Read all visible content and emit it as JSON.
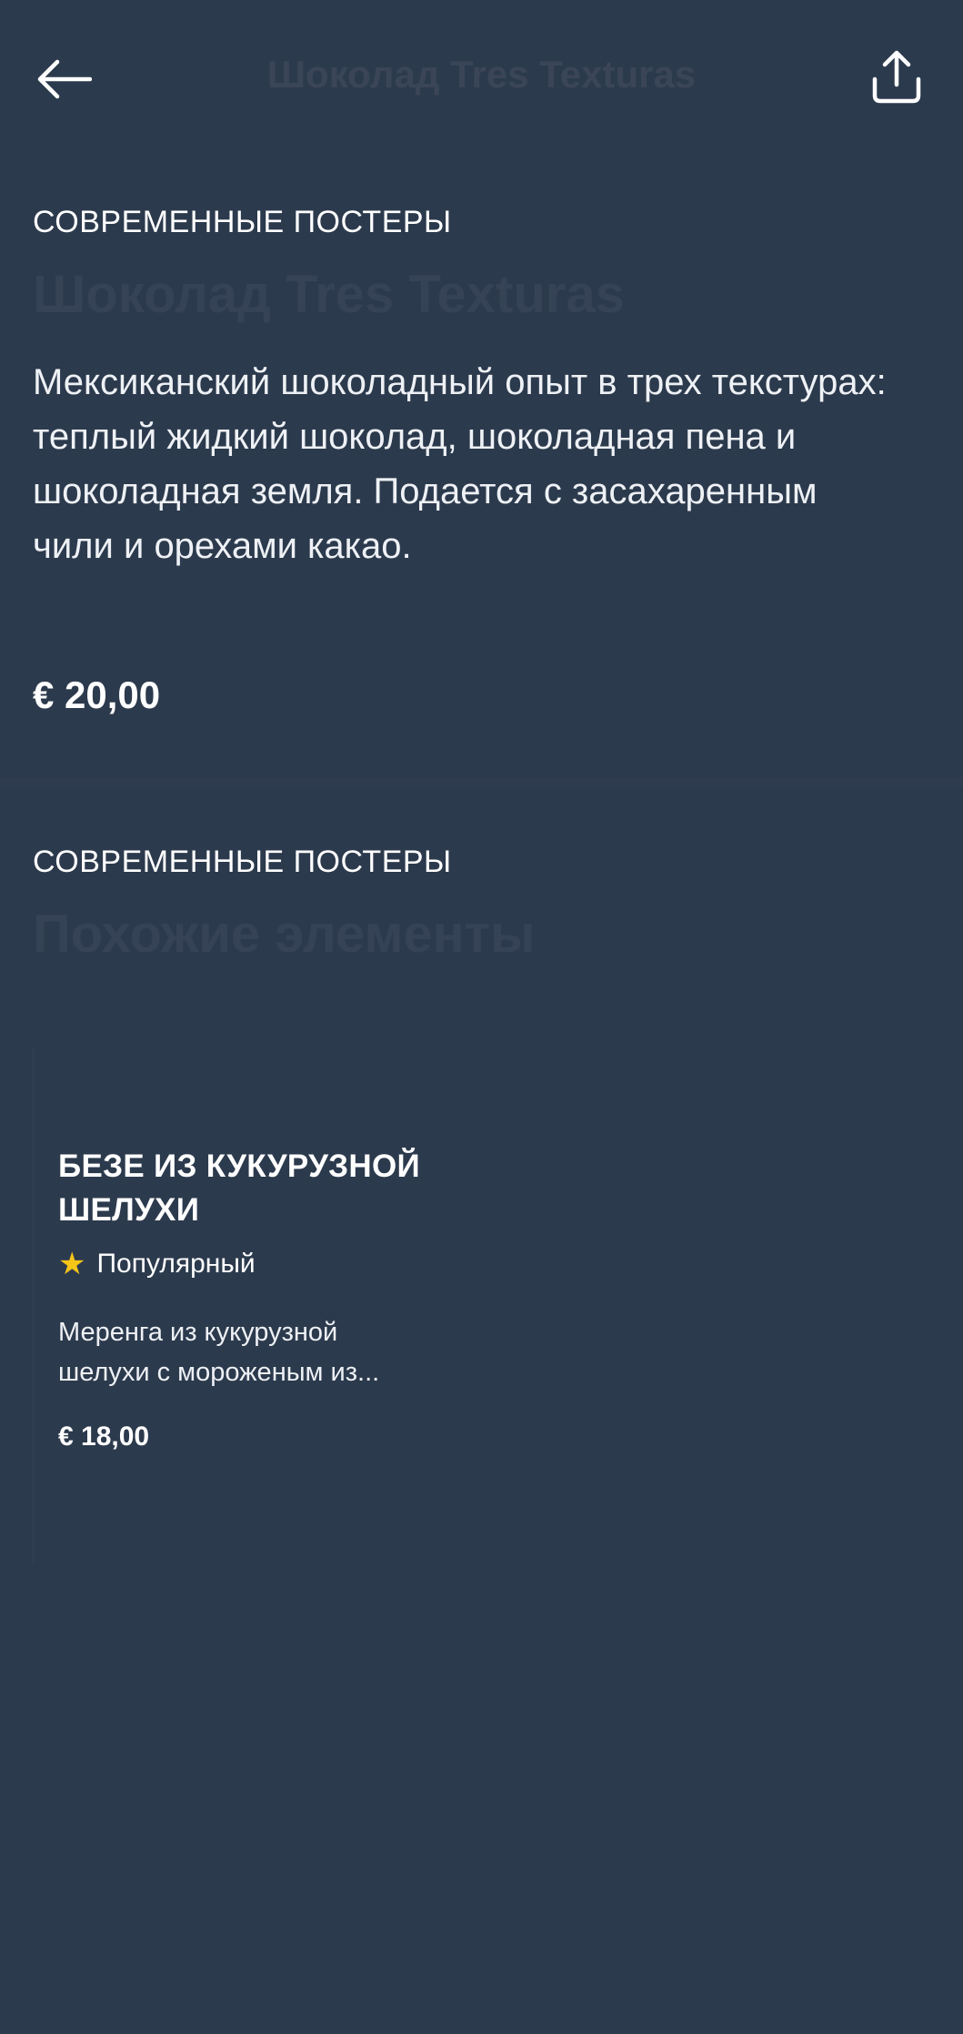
{
  "header": {
    "title": "Шоколад Tres Texturas",
    "back_icon": "arrow-left-icon",
    "share_icon": "share-icon"
  },
  "item": {
    "category": "СОВРЕМЕННЫЕ ПОСТЕРЫ",
    "title": "Шоколад Tres Texturas",
    "description": "Мексиканский шоколадный опыт в трех текстурах: теплый жидкий шоколад, шоколадная пена и шоколадная земля. Подается с засахаренным чили и орехами какао.",
    "price": "€ 20,00"
  },
  "similar": {
    "category": "СОВРЕМЕННЫЕ ПОСТЕРЫ",
    "heading": "Похожие элементы",
    "items": [
      {
        "title": "БЕЗЕ ИЗ КУКУРУЗНОЙ ШЕЛУХИ",
        "badge": "Популярный",
        "badge_icon": "star-icon",
        "description": "Меренга из кукурузной шелухи с мороженым из...",
        "price": "€ 18,00"
      }
    ]
  },
  "colors": {
    "background": "#2c3a4d",
    "star": "#f5c518",
    "muted_title": "#364356"
  }
}
